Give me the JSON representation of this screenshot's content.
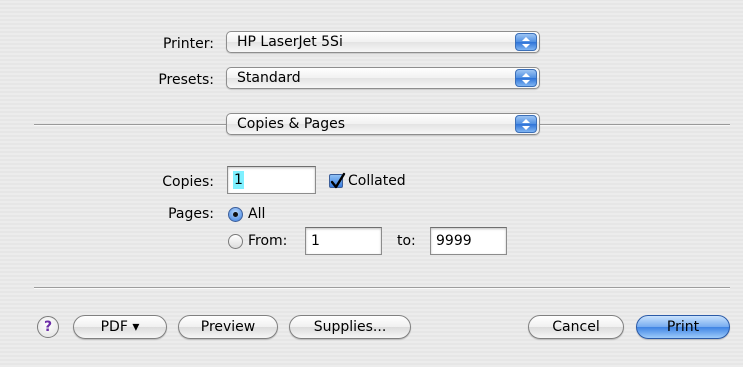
{
  "printer": {
    "label": "Printer:",
    "value": "HP LaserJet 5Si"
  },
  "presets": {
    "label": "Presets:",
    "value": "Standard"
  },
  "panel": {
    "value": "Copies & Pages"
  },
  "copies": {
    "label": "Copies:",
    "value": "1",
    "collated_label": "Collated",
    "collated": true
  },
  "pages": {
    "label": "Pages:",
    "all_label": "All",
    "from_label": "From:",
    "from_value": "1",
    "to_label": "to:",
    "to_value": "9999",
    "selected": "All"
  },
  "buttons": {
    "help": "?",
    "pdf": "PDF ▾",
    "preview": "Preview",
    "supplies": "Supplies...",
    "cancel": "Cancel",
    "print": "Print"
  },
  "colors": {
    "accent": "#3f84e4",
    "selection": "#7ff0ff",
    "help_glyph": "#6d2fa8"
  }
}
